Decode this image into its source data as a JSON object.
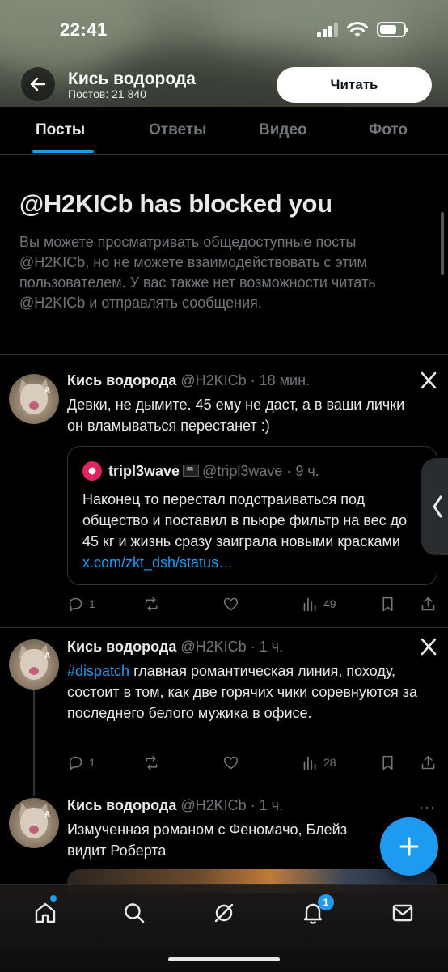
{
  "status_bar": {
    "time": "22:41"
  },
  "header": {
    "name": "Кись водорода",
    "posts_count": "Постов: 21 840",
    "follow_label": "Читать"
  },
  "tabs": [
    {
      "label": "Посты",
      "active": true
    },
    {
      "label": "Ответы",
      "active": false
    },
    {
      "label": "Видео",
      "active": false
    },
    {
      "label": "Фото",
      "active": false
    }
  ],
  "blocked": {
    "title": "@H2KICb has blocked you",
    "text": "Вы можете просматривать общедоступные посты @H2KICb, но не можете взаимодействовать с этим пользователем. У вас также нет возможности читать @H2KICb и отправлять сообщения."
  },
  "posts": [
    {
      "author": "Кись водорода",
      "handle": "@H2KICb",
      "time": "18 мин.",
      "text": "Девки, не дымите. 45 ему не даст, а в ваши лички он вламываться перестанет :)",
      "quote": {
        "author": "tripl3wave",
        "handle": "@tripl3wave",
        "time": "9 ч.",
        "text": "Наконец то перестал подстраиваться под общество и поставил в пьюре фильтр на вес до 45 кг и жизнь сразу заиграла новыми красками ",
        "link": "x.com/zkt_dsh/status…"
      },
      "replies": "1",
      "retweets": "",
      "likes": "",
      "views": "49"
    },
    {
      "author": "Кись водорода",
      "handle": "@H2KICb",
      "time": "1 ч.",
      "hashtag": "#dispatch",
      "text": " главная романтическая линия, походу, состоит в том, как две горячих чики соревнуются за последнего белого мужика в офисе.",
      "replies": "1",
      "retweets": "",
      "likes": "",
      "views": "28"
    },
    {
      "author": "Кись водорода",
      "handle": "@H2KICb",
      "time": "1 ч.",
      "text": "Измученная романом с Феномачо, Блейз видит Роберта"
    }
  ],
  "bottom_nav": {
    "notifications_badge": "1"
  },
  "colors": {
    "accent": "#1d9bf0",
    "background": "#000000",
    "muted": "#71767b",
    "divider": "#2f3336"
  }
}
